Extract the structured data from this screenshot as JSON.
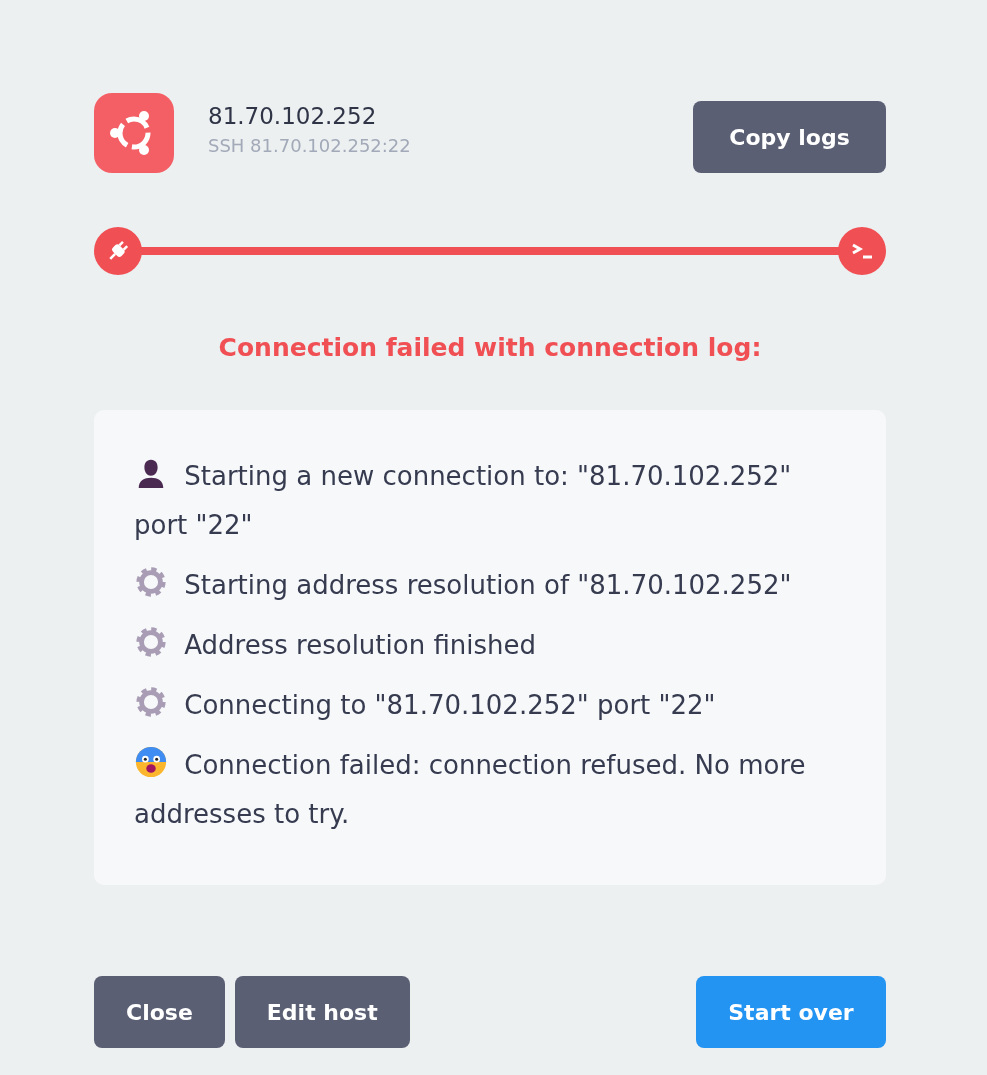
{
  "host": {
    "name": "81.70.102.252",
    "address": "SSH 81.70.102.252:22"
  },
  "copy_button": "Copy logs",
  "progress": {
    "failed": true
  },
  "message": "Connection failed with connection log:",
  "log": [
    {
      "kind": "user",
      "text": "Starting a new connection to: \"81.70.102.252\" port \"22\""
    },
    {
      "kind": "gear",
      "text": "Starting address resolution of \"81.70.102.252\""
    },
    {
      "kind": "gear",
      "text": "Address resolution finished"
    },
    {
      "kind": "gear",
      "text": "Connecting to \"81.70.102.252\" port \"22\""
    },
    {
      "kind": "scared",
      "text": "Connection failed: connection refused. No more addresses to try."
    }
  ],
  "buttons": [
    {
      "label": "Close",
      "kind": "secondary"
    },
    {
      "label": "Edit host",
      "kind": "secondary"
    },
    {
      "label": "Start over",
      "kind": "primary"
    }
  ]
}
